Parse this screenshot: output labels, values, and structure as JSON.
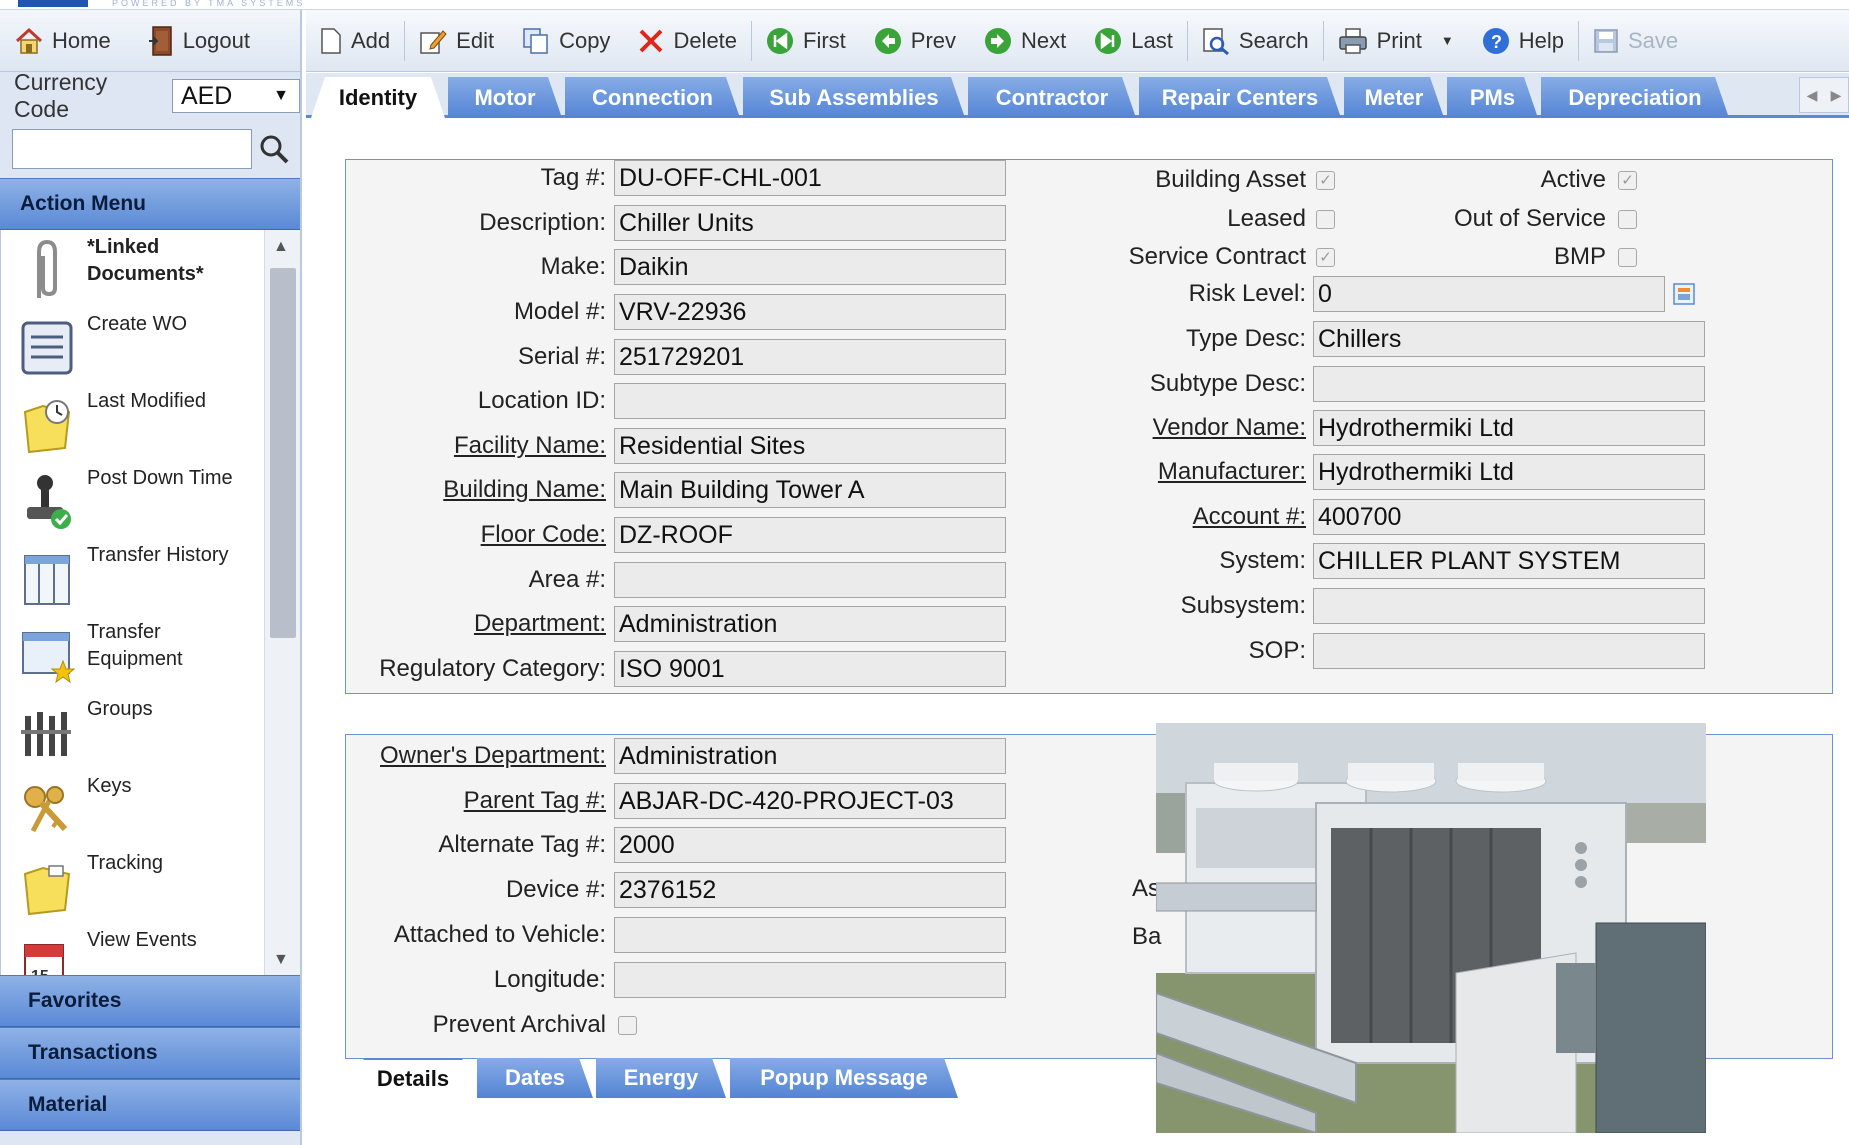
{
  "brand": {
    "text": "POWERED BY TMA SYSTEMS"
  },
  "nav": {
    "home": "Home",
    "logout": "Logout"
  },
  "currency": {
    "label": "Currency Code",
    "value": "AED"
  },
  "search": {
    "placeholder": ""
  },
  "action_menu": {
    "title": "Action Menu",
    "items": [
      {
        "label": "*Linked Documents*",
        "icon": "paperclip-icon"
      },
      {
        "label": "Create WO",
        "icon": "work-order-icon"
      },
      {
        "label": "Last Modified",
        "icon": "folder-clock-icon"
      },
      {
        "label": "Post Down Time",
        "icon": "stamp-icon"
      },
      {
        "label": "Transfer History",
        "icon": "table-history-icon"
      },
      {
        "label": "Transfer Equipment",
        "icon": "window-star-icon"
      },
      {
        "label": "Groups",
        "icon": "groups-icon"
      },
      {
        "label": "Keys",
        "icon": "keys-icon"
      },
      {
        "label": "Tracking",
        "icon": "tracking-folder-icon"
      },
      {
        "label": "View Events",
        "icon": "calendar-icon"
      }
    ]
  },
  "accordion": {
    "favorites": "Favorites",
    "transactions": "Transactions",
    "material": "Material"
  },
  "toolbar": {
    "add": "Add",
    "edit": "Edit",
    "copy": "Copy",
    "delete": "Delete",
    "first": "First",
    "prev": "Prev",
    "next": "Next",
    "last": "Last",
    "search": "Search",
    "print": "Print",
    "help": "Help",
    "save": "Save"
  },
  "tabs": [
    "Identity",
    "Motor",
    "Connection",
    "Sub Assemblies",
    "Contractor",
    "Repair Centers",
    "Meter",
    "PMs",
    "Depreciation"
  ],
  "identity": {
    "tag_label": "Tag #:",
    "tag": "DU-OFF-CHL-001",
    "description_label": "Description:",
    "description": "Chiller Units",
    "make_label": "Make:",
    "make": "Daikin",
    "model_label": "Model #:",
    "model": "VRV-22936",
    "serial_label": "Serial #:",
    "serial": "251729201",
    "location_label": "Location ID:",
    "location": "",
    "facility_label": "Facility Name:",
    "facility": "Residential Sites",
    "building_label": "Building Name:",
    "building": "Main Building Tower A",
    "floor_label": "Floor Code:",
    "floor": "DZ-ROOF",
    "area_label": "Area #:",
    "area": "",
    "department_label": "Department:",
    "department": "Administration",
    "regulatory_label": "Regulatory Category:",
    "regulatory": "ISO 9001",
    "building_asset_label": "Building Asset",
    "building_asset": true,
    "active_label": "Active",
    "active": true,
    "leased_label": "Leased",
    "leased": false,
    "out_of_service_label": "Out of Service",
    "out_of_service": false,
    "service_contract_label": "Service Contract",
    "service_contract": true,
    "bmp_label": "BMP",
    "bmp": false,
    "risk_label": "Risk Level:",
    "risk": "0",
    "type_label": "Type Desc:",
    "type": "Chillers",
    "subtype_label": "Subtype Desc:",
    "subtype": "",
    "vendor_label": "Vendor Name:",
    "vendor": "Hydrothermiki Ltd",
    "manufacturer_label": "Manufacturer:",
    "manufacturer": "Hydrothermiki Ltd",
    "account_label": "Account #:",
    "account": "400700",
    "system_label": "System:",
    "system": "CHILLER PLANT SYSTEM",
    "subsystem_label": "Subsystem:",
    "subsystem": "",
    "sop_label": "SOP:",
    "sop": ""
  },
  "details": {
    "owner_dept_label": "Owner's Department:",
    "owner_dept": "Administration",
    "parent_tag_label": "Parent Tag #:",
    "parent_tag": "ABJAR-DC-420-PROJECT-03",
    "alt_tag_label": "Alternate Tag #:",
    "alt_tag": "2000",
    "device_label": "Device #:",
    "device": "2376152",
    "vehicle_label": "Attached to Vehicle:",
    "vehicle": "",
    "longitude_label": "Longitude:",
    "longitude": "",
    "archival_label": "Prevent Archival",
    "archival": false,
    "partial_label_1": "As",
    "partial_label_2": "Ba"
  },
  "subtabs": [
    "Details",
    "Dates",
    "Energy",
    "Popup Message"
  ]
}
